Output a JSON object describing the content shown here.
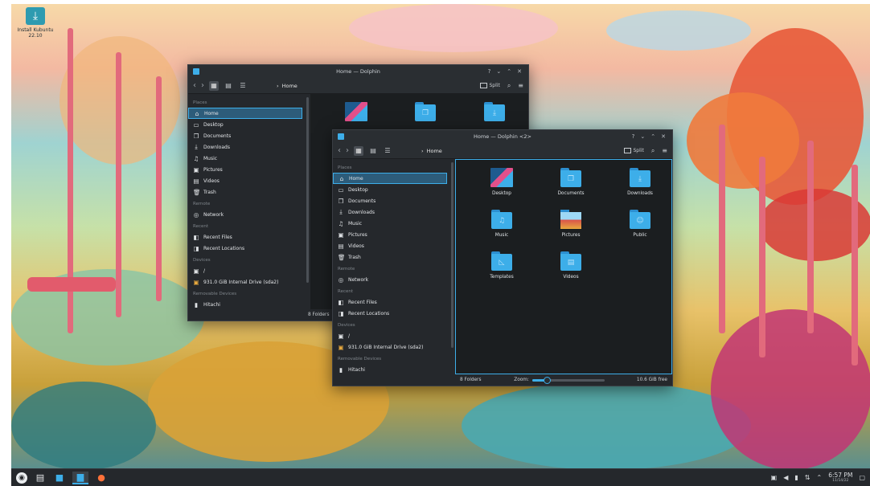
{
  "desktop": {
    "icon_label": "Install Kubuntu 22.10"
  },
  "back_window": {
    "title": "Home — Dolphin",
    "breadcrumb": "Home",
    "split_label": "Split",
    "status_text": "8 Folders",
    "places_header": "Places",
    "remote_header": "Remote",
    "recent_header": "Recent",
    "devices_header": "Devices",
    "removable_header": "Removable Devices",
    "places": [
      "Home",
      "Desktop",
      "Documents",
      "Downloads",
      "Music",
      "Pictures",
      "Videos",
      "Trash"
    ],
    "remote": [
      "Network"
    ],
    "recent": [
      "Recent Files",
      "Recent Locations"
    ],
    "devices": [
      "/",
      "931.0 GiB Internal Drive (sda2)"
    ],
    "removable": [
      "Hitachi"
    ]
  },
  "front_window": {
    "title": "Home — Dolphin <2>",
    "breadcrumb": "Home",
    "split_label": "Split",
    "places_header": "Places",
    "remote_header": "Remote",
    "recent_header": "Recent",
    "devices_header": "Devices",
    "removable_header": "Removable Devices",
    "places": [
      "Home",
      "Desktop",
      "Documents",
      "Downloads",
      "Music",
      "Pictures",
      "Videos",
      "Trash"
    ],
    "remote": [
      "Network"
    ],
    "recent": [
      "Recent Files",
      "Recent Locations"
    ],
    "devices": [
      "/",
      "931.0 GiB Internal Drive (sda2)"
    ],
    "removable": [
      "Hitachi"
    ],
    "files": [
      "Desktop",
      "Documents",
      "Downloads",
      "Music",
      "Pictures",
      "Public",
      "Templates",
      "Videos"
    ],
    "status_text": "8 Folders",
    "zoom_label": "Zoom:",
    "zoom_level": 0.2,
    "free_space": "10.6 GiB free"
  },
  "taskbar": {
    "time": "6:57 PM",
    "date": "11/14/22"
  },
  "colors": {
    "accent": "#3daee9",
    "window_bg": "#202326",
    "panel_bg": "#25282c"
  }
}
